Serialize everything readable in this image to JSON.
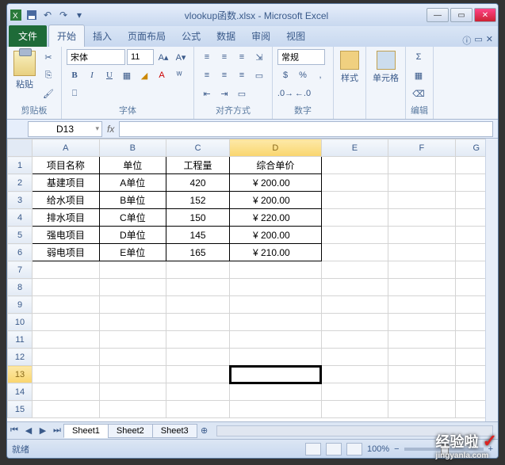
{
  "app": {
    "title": "vlookup函数.xlsx - Microsoft Excel"
  },
  "qat": {
    "save": "save-icon",
    "undo": "undo-icon",
    "redo": "redo-icon"
  },
  "win": {
    "minimize": "—",
    "maximize": "▭",
    "close": "✕"
  },
  "tabs": {
    "file": "文件",
    "home": "开始",
    "insert": "插入",
    "layout": "页面布局",
    "formulas": "公式",
    "data": "数据",
    "review": "审阅",
    "view": "视图"
  },
  "ribbon": {
    "clipboard": {
      "label": "剪贴板",
      "paste": "粘贴"
    },
    "font": {
      "label": "字体",
      "name": "宋体",
      "size": "11",
      "bold": "B",
      "italic": "I",
      "underline": "U"
    },
    "align": {
      "label": "对齐方式"
    },
    "number": {
      "label": "数字",
      "format": "常规"
    },
    "styles": {
      "label": "样式"
    },
    "cells": {
      "label": "单元格"
    },
    "editing": {
      "label": "编辑"
    }
  },
  "namebox": "D13",
  "columns": [
    "A",
    "B",
    "C",
    "D",
    "E",
    "F",
    "G"
  ],
  "table": {
    "headers": [
      "项目名称",
      "单位",
      "工程量",
      "综合单价"
    ],
    "rows": [
      [
        "基建项目",
        "A单位",
        "420",
        "¥  200.00"
      ],
      [
        "给水项目",
        "B单位",
        "152",
        "¥  200.00"
      ],
      [
        "排水项目",
        "C单位",
        "150",
        "¥  220.00"
      ],
      [
        "强电项目",
        "D单位",
        "145",
        "¥  200.00"
      ],
      [
        "弱电项目",
        "E单位",
        "165",
        "¥  210.00"
      ]
    ]
  },
  "chart_data": {
    "type": "table",
    "columns": [
      "项目名称",
      "单位",
      "工程量",
      "综合单价"
    ],
    "rows": [
      {
        "项目名称": "基建项目",
        "单位": "A单位",
        "工程量": 420,
        "综合单价": 200.0
      },
      {
        "项目名称": "给水项目",
        "单位": "B单位",
        "工程量": 152,
        "综合单价": 200.0
      },
      {
        "项目名称": "排水项目",
        "单位": "C单位",
        "工程量": 150,
        "综合单价": 220.0
      },
      {
        "项目名称": "强电项目",
        "单位": "D单位",
        "工程量": 145,
        "综合单价": 200.0
      },
      {
        "项目名称": "弱电项目",
        "单位": "E单位",
        "工程量": 165,
        "综合单价": 210.0
      }
    ]
  },
  "sheets": [
    "Sheet1",
    "Sheet2",
    "Sheet3"
  ],
  "status": {
    "ready": "就绪",
    "zoom": "100%",
    "minus": "−",
    "plus": "+"
  },
  "watermark": {
    "text": "经验啦",
    "sub": "jingyanla.com",
    "check": "✓"
  }
}
